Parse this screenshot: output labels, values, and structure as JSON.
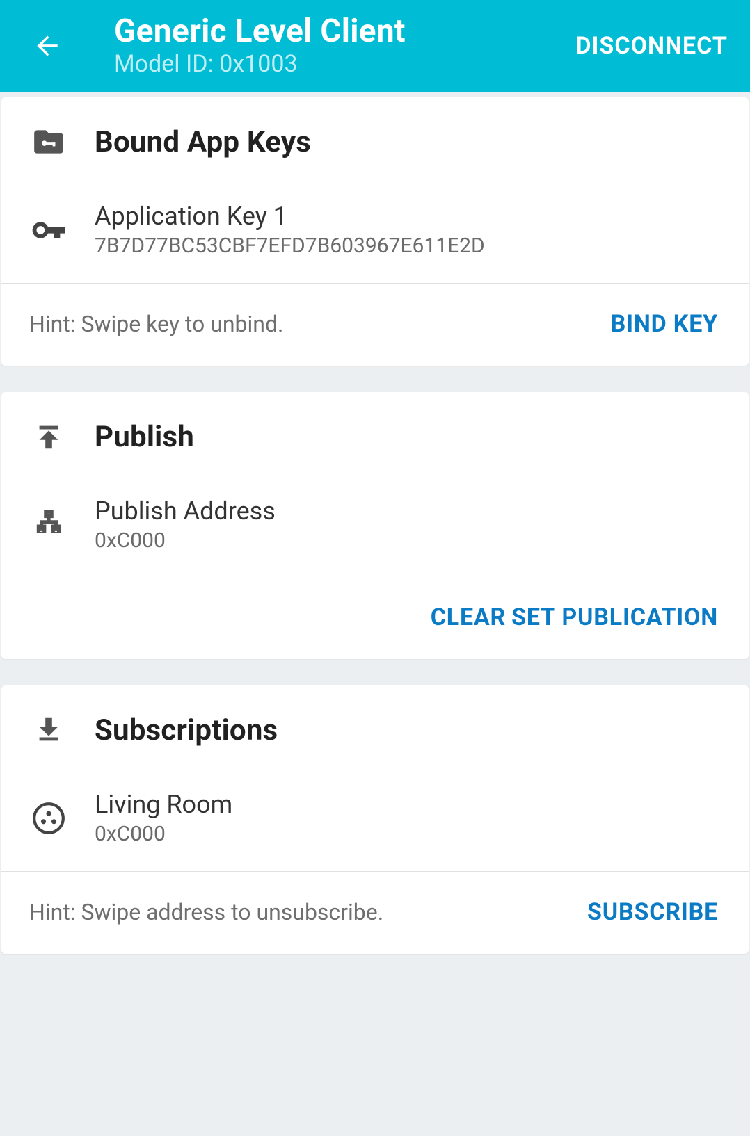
{
  "header": {
    "title": "Generic Level Client",
    "subtitle": "Model ID: 0x1003",
    "disconnect": "DISCONNECT"
  },
  "bound_keys": {
    "section_title": "Bound App Keys",
    "key": {
      "title": "Application Key 1",
      "value": "7B7D77BC53CBF7EFD7B603967E611E2D"
    },
    "hint": "Hint: Swipe key to unbind.",
    "bind_button": "BIND KEY"
  },
  "publish": {
    "section_title": "Publish",
    "address": {
      "title": "Publish Address",
      "value": "0xC000"
    },
    "clear_button": "CLEAR",
    "set_button": "SET PUBLICATION"
  },
  "subscriptions": {
    "section_title": "Subscriptions",
    "item": {
      "title": "Living Room",
      "value": "0xC000"
    },
    "hint": "Hint: Swipe address to unsubscribe.",
    "subscribe_button": "SUBSCRIBE"
  }
}
